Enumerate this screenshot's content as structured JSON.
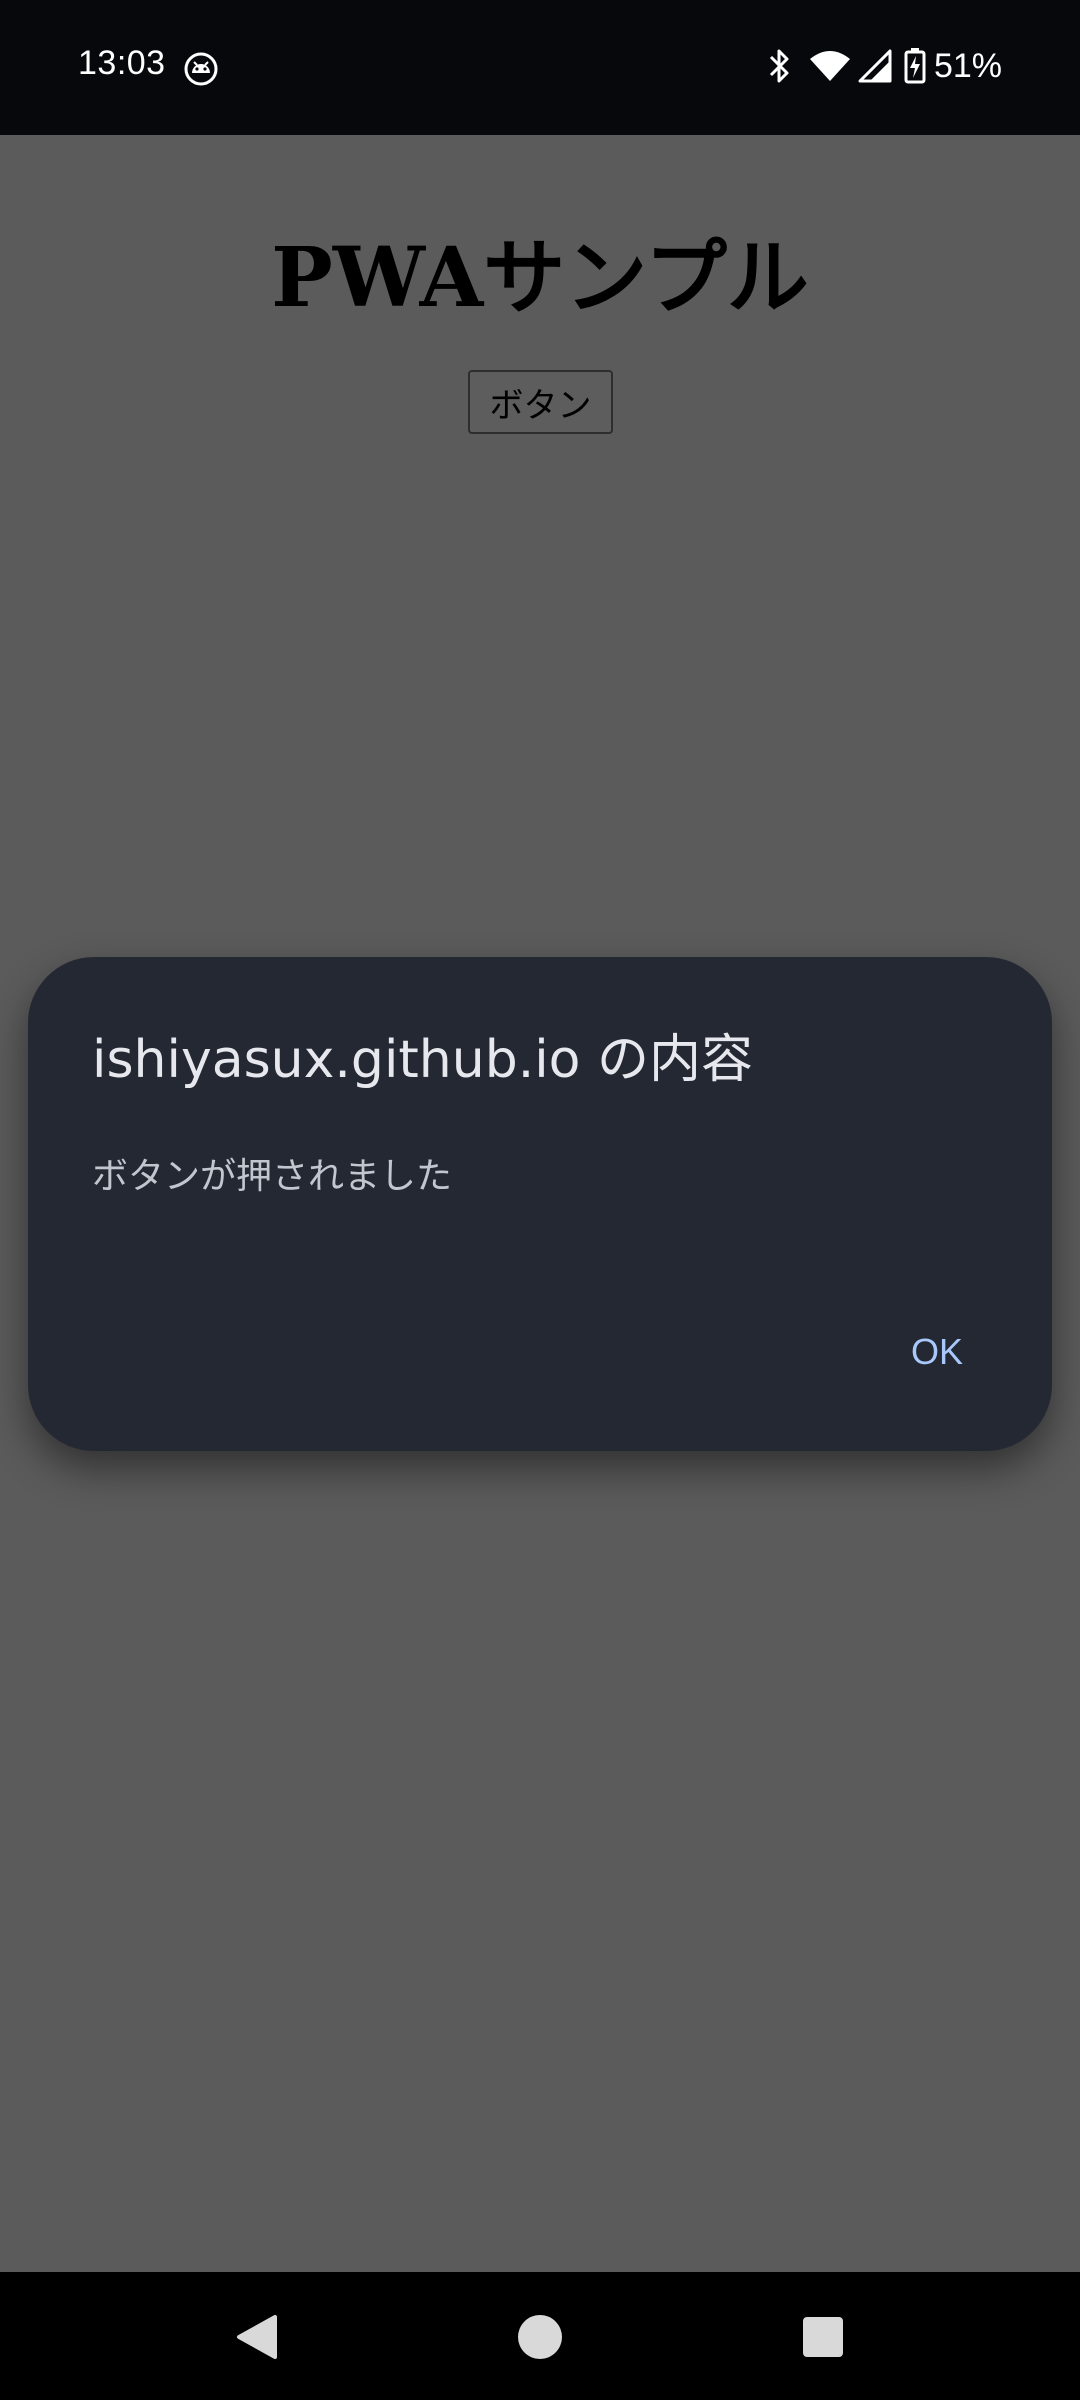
{
  "status_bar": {
    "time": "13:03",
    "left_icon": "android-face-icon",
    "right_icons": [
      "bluetooth-icon",
      "wifi-icon",
      "signal-icon",
      "battery-charging-icon"
    ],
    "battery_percent": "51%"
  },
  "page": {
    "title": "PWAサンプル",
    "button_label": "ボタン"
  },
  "dialog": {
    "title": "ishiyasux.github.io の内容",
    "message": "ボタンが押されました",
    "ok_label": "OK"
  },
  "nav_bar": {
    "buttons": [
      "back-icon",
      "home-icon",
      "recents-icon"
    ]
  },
  "colors": {
    "scrim_background": "#5b5b5b",
    "dialog_background": "#232832",
    "accent": "#a8c8fb"
  }
}
